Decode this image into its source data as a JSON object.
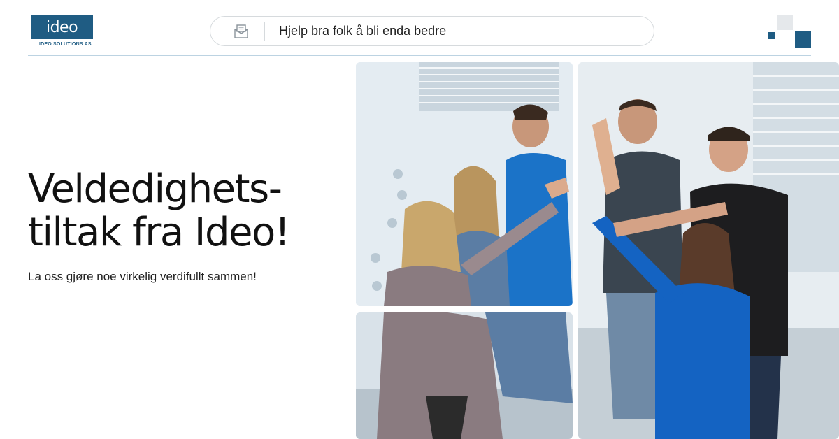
{
  "brand": {
    "logo_text": "ideo",
    "company_name": "IDEO SOLUTIONS AS",
    "primary_color": "#1f5c83"
  },
  "search": {
    "icon": "mail-icon",
    "text": "Hjelp bra folk å bli enda bedre"
  },
  "hero": {
    "title_line1": "Veldedighets-",
    "title_line2": "tiltak fra Ideo!",
    "subtitle": "La oss gjøre noe virkelig verdifullt sammen!"
  },
  "photos": {
    "subject": "team-high-five-photo"
  }
}
